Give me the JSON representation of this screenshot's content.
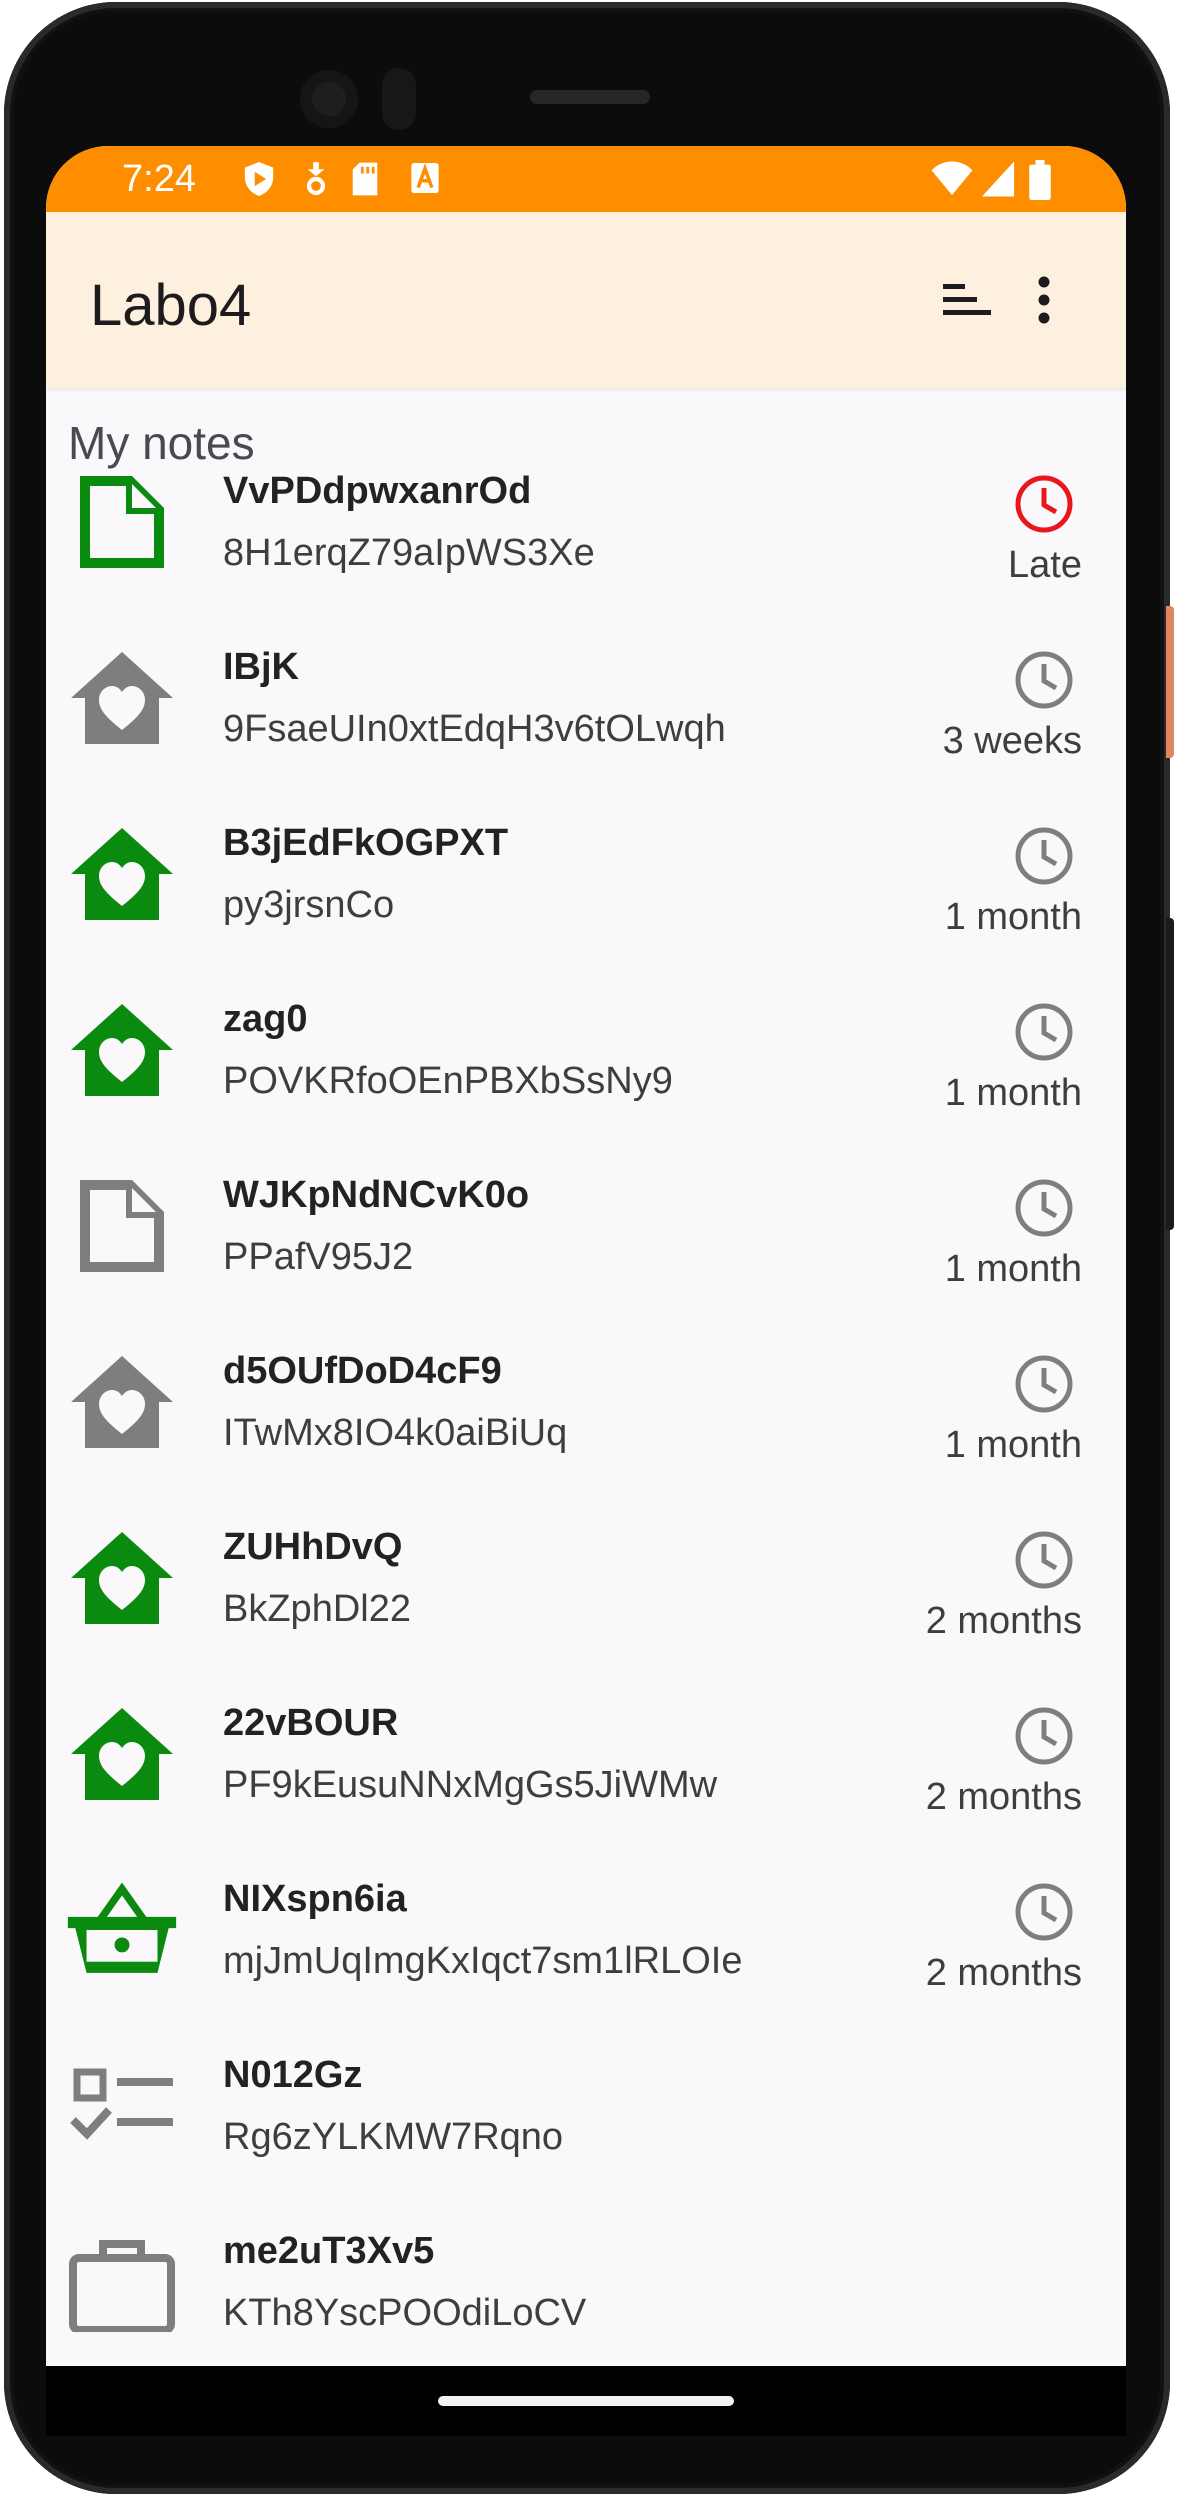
{
  "status_bar": {
    "time": "7:24",
    "left_icons": [
      "shield-icon",
      "download-icon",
      "sd-card-icon",
      "text-a-icon"
    ],
    "right_icons": [
      "wifi-icon",
      "signal-icon",
      "battery-icon"
    ],
    "color": "#fe8d00"
  },
  "app_bar": {
    "title": "Labo4",
    "actions": [
      "sort-icon",
      "more-vert-icon"
    ],
    "color": "#fdf0df"
  },
  "section": {
    "title": "My notes"
  },
  "notes": [
    {
      "title": "VvPDdpwxanrOd",
      "subtitle": "8H1erqZ79aIpWS3Xe",
      "icon": "document-icon",
      "icon_color": "#0b8a10",
      "due": "Late",
      "clock_color": "#e8171a"
    },
    {
      "title": "IBjK",
      "subtitle": "9FsaeUIn0xtEdqH3v6tOLwqh",
      "icon": "home-heart-icon",
      "icon_color": "#7e7e7e",
      "due": "3 weeks",
      "clock_color": "#7e7e7e"
    },
    {
      "title": "B3jEdFkOGPXT",
      "subtitle": "py3jrsnCo",
      "icon": "home-heart-icon",
      "icon_color": "#0b8a10",
      "due": "1 month",
      "clock_color": "#7e7e7e"
    },
    {
      "title": "zag0",
      "subtitle": "POVKRfoOEnPBXbSsNy9",
      "icon": "home-heart-icon",
      "icon_color": "#0b8a10",
      "due": "1 month",
      "clock_color": "#7e7e7e"
    },
    {
      "title": "WJKpNdNCvK0o",
      "subtitle": "PPafV95J2",
      "icon": "document-icon",
      "icon_color": "#7e7e7e",
      "due": "1 month",
      "clock_color": "#7e7e7e"
    },
    {
      "title": "d5OUfDoD4cF9",
      "subtitle": "ITwMx8IO4k0aiBiUq",
      "icon": "home-heart-icon",
      "icon_color": "#7e7e7e",
      "due": "1 month",
      "clock_color": "#7e7e7e"
    },
    {
      "title": "ZUHhDvQ",
      "subtitle": "BkZphDl22",
      "icon": "home-heart-icon",
      "icon_color": "#0b8a10",
      "due": "2 months",
      "clock_color": "#7e7e7e"
    },
    {
      "title": "22vBOUR",
      "subtitle": "PF9kEusuNNxMgGs5JiWMw",
      "icon": "home-heart-icon",
      "icon_color": "#0b8a10",
      "due": "2 months",
      "clock_color": "#7e7e7e"
    },
    {
      "title": "NIXspn6ia",
      "subtitle": "mjJmUqImgKxIqct7sm1lRLOIe",
      "icon": "basket-icon",
      "icon_color": "#0b8a10",
      "due": "2 months",
      "clock_color": "#7e7e7e"
    },
    {
      "title": "N012Gz",
      "subtitle": "Rg6zYLKMW7Rqno",
      "icon": "checklist-icon",
      "icon_color": "#7e7e7e",
      "due": "",
      "clock_color": ""
    },
    {
      "title": "me2uT3Xv5",
      "subtitle": "KTh8YscPOOdiLoCV",
      "icon": "briefcase-icon",
      "icon_color": "#7e7e7e",
      "due": "",
      "clock_color": ""
    }
  ]
}
